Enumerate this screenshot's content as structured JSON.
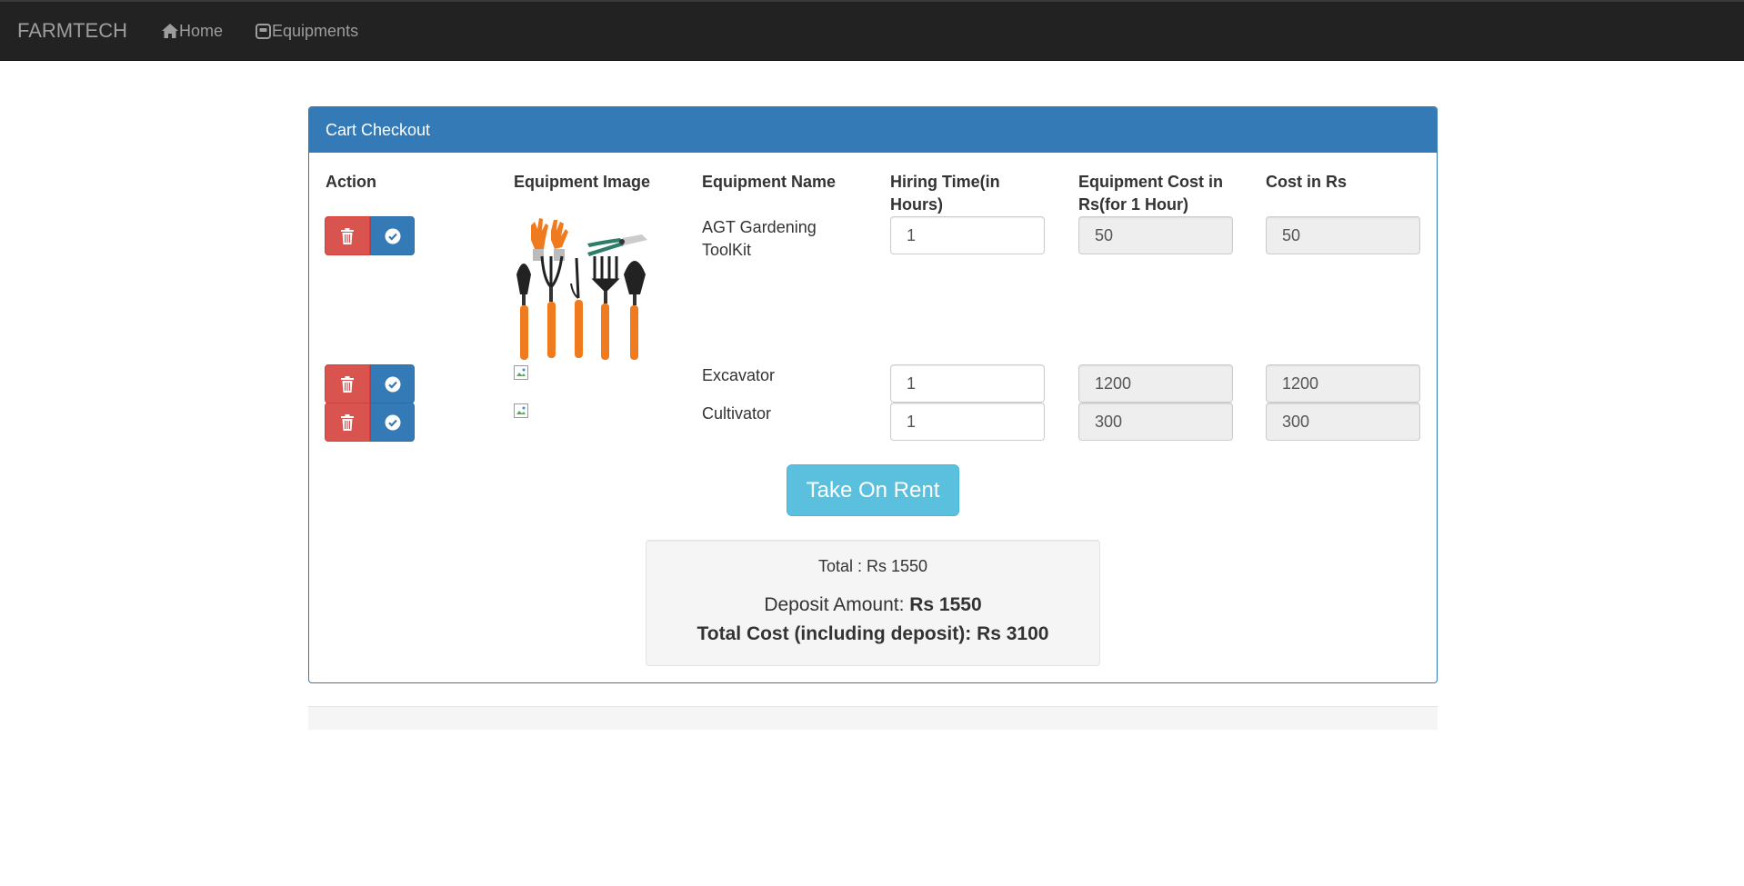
{
  "nav": {
    "brand": "FARMTECH",
    "home": "Home",
    "equipments": "Equipments"
  },
  "panel": {
    "title": "Cart Checkout",
    "columns": {
      "action": "Action",
      "image": "Equipment Image",
      "name": "Equipment Name",
      "hours_1": "Hiring Time(in",
      "hours_2": "Hours)",
      "unit_1": "Equipment Cost in",
      "unit_2": "Rs(for 1 Hour)",
      "cost": "Cost in Rs"
    },
    "rows": [
      {
        "name_1": "AGT Gardening",
        "name_2": "ToolKit",
        "hours": "1",
        "unit_cost": "50",
        "cost": "50"
      },
      {
        "name_1": "Excavator",
        "hours": "1",
        "unit_cost": "1200",
        "cost": "1200"
      },
      {
        "name_1": "Cultivator",
        "hours": "1",
        "unit_cost": "300",
        "cost": "300"
      }
    ]
  },
  "rent_button": "Take On Rent",
  "summary": {
    "total": "Total : Rs 1550",
    "deposit_label": "Deposit Amount: ",
    "deposit_value": "Rs 1550",
    "grand_total": "Total Cost (including deposit): Rs 3100"
  },
  "colors": {
    "navbar": "#222222",
    "primary": "#337ab7",
    "danger": "#d9534f",
    "info": "#5bc0de"
  }
}
